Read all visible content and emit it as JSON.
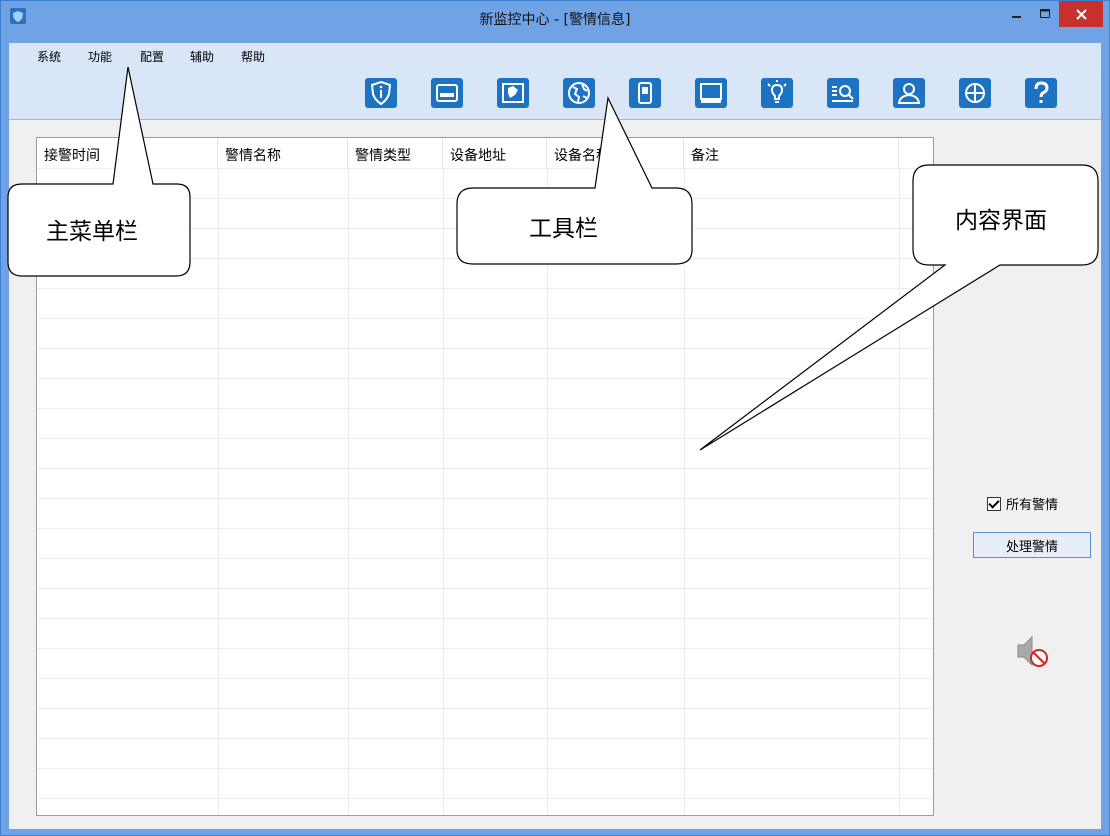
{
  "window": {
    "title": "新监控中心 - [警情信息]"
  },
  "menu": [
    "系统",
    "功能",
    "配置",
    "辅助",
    "帮助"
  ],
  "toolbar": {
    "icons": [
      "shield-info-icon",
      "keyboard-panel-icon",
      "map-icon",
      "globe-icon",
      "mobile-device-icon",
      "monitor-icon",
      "lightbulb-icon",
      "search-list-icon",
      "user-icon",
      "crosshair-icon",
      "help-icon"
    ]
  },
  "table": {
    "columns": [
      "接警时间",
      "警情名称",
      "警情类型",
      "设备地址",
      "设备名称",
      "备注"
    ]
  },
  "side": {
    "checkbox_label": "所有警情",
    "checkbox_checked": true,
    "button_label": "处理警情"
  },
  "annotations": {
    "menu_callout": "主菜单栏",
    "toolbar_callout": "工具栏",
    "content_callout": "内容界面"
  },
  "colors": {
    "title_bar": "#6fa3e6",
    "menu_bg": "#d8e6f8",
    "toolbar_icon": "#1d73c2",
    "close_button": "#c7302b"
  }
}
